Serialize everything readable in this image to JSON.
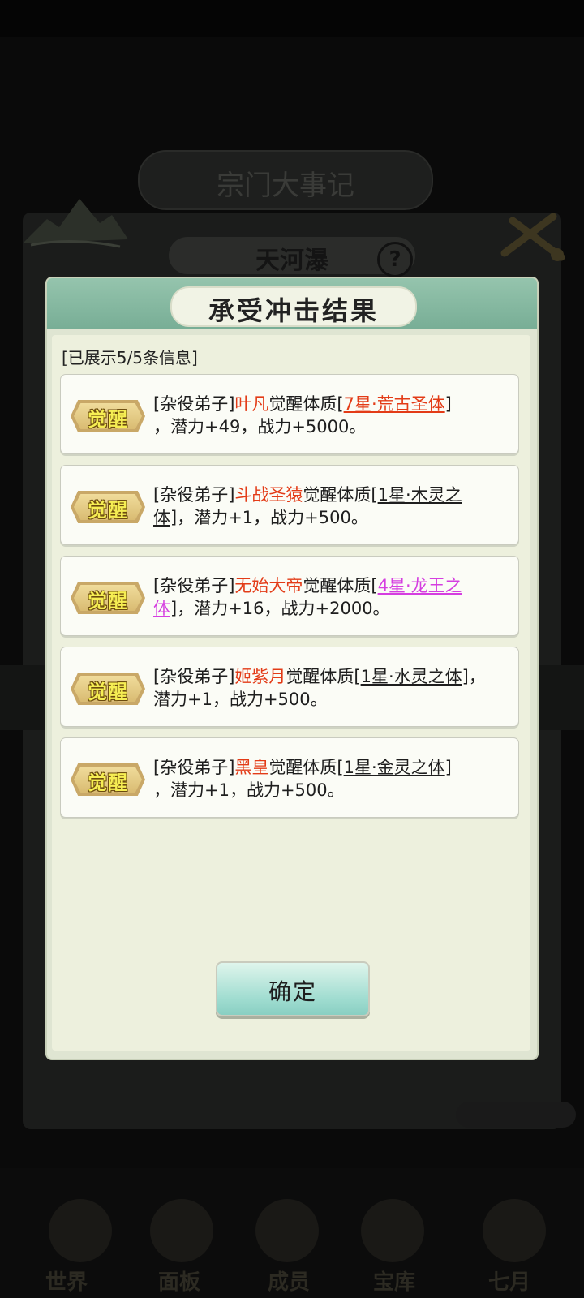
{
  "background": {
    "banner_title": "宗门大事记",
    "subtitle": "天河瀑",
    "help_symbol": "?",
    "nav_items": [
      "世界",
      "面板",
      "成员",
      "宝库",
      "七月"
    ]
  },
  "dialog": {
    "title": "承受冲击结果",
    "count_text": "[已展示5/5条信息]",
    "entries": [
      {
        "badge": "觉醒",
        "prefix": "[杂役弟子]",
        "name": "叶凡",
        "action": "觉醒体质",
        "open": "[",
        "quality": "7星·荒古圣体",
        "close": "]",
        "rest": "，潜力+49，战力+5000。",
        "quality_color": "#e33b17"
      },
      {
        "badge": "觉醒",
        "prefix": "[杂役弟子]",
        "name": "斗战圣猿",
        "action": "觉醒体质",
        "open": "[",
        "quality": "1星·木灵之体",
        "close": "]",
        "rest": "，潜力+1，战力+500。",
        "quality_color": "#1e1e1e"
      },
      {
        "badge": "觉醒",
        "prefix": "[杂役弟子]",
        "name": "无始大帝",
        "action": "觉醒体质",
        "open": "[",
        "quality": "4星·龙王之体",
        "close": "]",
        "rest": "，潜力+16，战力+2000。",
        "quality_color": "#d53ee0"
      },
      {
        "badge": "觉醒",
        "prefix": "[杂役弟子]",
        "name": "姬紫月",
        "action": "觉醒体质",
        "open": "[",
        "quality": "1星·水灵之体",
        "close": "]",
        "rest": "，潜力+1，战力+500。",
        "quality_color": "#1e1e1e"
      },
      {
        "badge": "觉醒",
        "prefix": "[杂役弟子]",
        "name": "黑皇",
        "action": "觉醒体质",
        "open": "[",
        "quality": "1星·金灵之体",
        "close": "]",
        "rest": "，潜力+1，战力+500。",
        "quality_color": "#1e1e1e"
      }
    ],
    "confirm_label": "确定"
  },
  "colors": {
    "header_green": "#78ae96",
    "name_red": "#e33b17",
    "quality_purple": "#d53ee0",
    "badge_gold": "#c9a867",
    "confirm_teal": "#9fdcd0"
  },
  "icons": [
    "mountain-icon",
    "cloud-ornament-icon",
    "help-icon",
    "awaken-badge-icon"
  ]
}
